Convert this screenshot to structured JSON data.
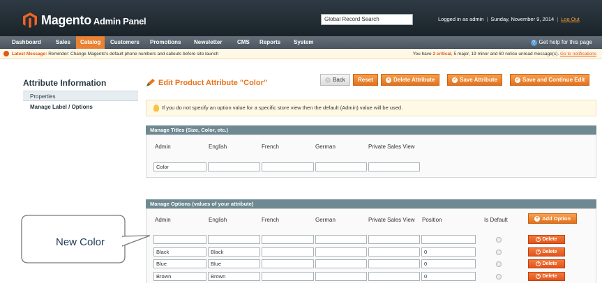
{
  "header": {
    "brand": "Magento",
    "brand_sub": "Admin Panel",
    "search_value": "Global Record Search",
    "logged_in": "Logged in as admin",
    "date": "Sunday, November 9, 2014",
    "logout": "Log Out"
  },
  "nav": {
    "items": [
      "Dashboard",
      "Sales",
      "Catalog",
      "Customers",
      "Promotions",
      "Newsletter",
      "CMS",
      "Reports",
      "System"
    ],
    "active": "Catalog",
    "help": "Get help for this page"
  },
  "notice": {
    "label": "Latest Message:",
    "message": "Reminder: Change Magento's default phone numbers and callouts before site launch",
    "prefix": "You have",
    "critical": "2 critical",
    "rest": ", 5 major, 19 minor and 60 notice unread message(s).",
    "link": "Go to notifications"
  },
  "sidebar": {
    "title": "Attribute Information",
    "tabs": [
      "Properties",
      "Manage Label / Options"
    ]
  },
  "page": {
    "title": "Edit Product Attribute \"Color\"",
    "buttons": {
      "back": "Back",
      "reset": "Reset",
      "delete": "Delete Attribute",
      "save": "Save Attribute",
      "save_continue": "Save and Continue Edit"
    },
    "info": "If you do not specify an option value for a specific store view then the default (Admin) value will be used."
  },
  "titles_section": {
    "heading": "Manage Titles (Size, Color, etc.)",
    "columns": [
      "Admin",
      "English",
      "French",
      "German",
      "Private Sales View"
    ],
    "values": [
      "Color",
      "",
      "",
      "",
      ""
    ]
  },
  "options_section": {
    "heading": "Manage Options (values of your attribute)",
    "columns": [
      "Admin",
      "English",
      "French",
      "German",
      "Private Sales View",
      "Position",
      "Is Default"
    ],
    "add_label": "Add Option",
    "delete_label": "Delete",
    "rows": [
      {
        "admin": "",
        "english": "",
        "french": "",
        "german": "",
        "private": "",
        "position": ""
      },
      {
        "admin": "Black",
        "english": "Black",
        "french": "",
        "german": "",
        "private": "",
        "position": "0"
      },
      {
        "admin": "Blue",
        "english": "Blue",
        "french": "",
        "german": "",
        "private": "",
        "position": "0"
      },
      {
        "admin": "Brown",
        "english": "Brown",
        "french": "",
        "german": "",
        "private": "",
        "position": "0"
      }
    ]
  },
  "callout": {
    "text": "New Color"
  },
  "colors": {
    "accent": "#e98233",
    "header_bg": "#2e3a44",
    "section_header": "#6f8992"
  }
}
